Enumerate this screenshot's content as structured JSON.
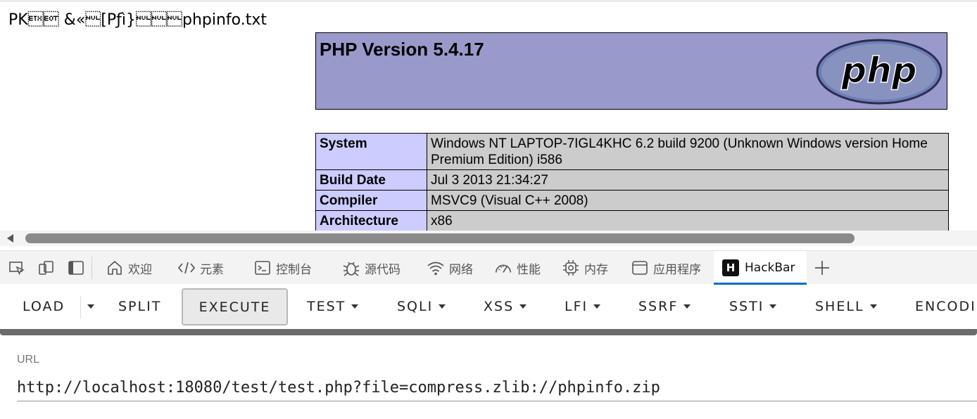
{
  "page": {
    "raw_text": "PK\u0003\u0004 &«\u0000[Pƒì}\u0000\u0000\u0000phpinfo.txt",
    "php_title": "PHP Version 5.4.17",
    "logo_text": "php",
    "info_rows": [
      {
        "key": "System",
        "value": "Windows NT LAPTOP-7IGL4KHC 6.2 build 9200 (Unknown Windows version Home Premium Edition) i586"
      },
      {
        "key": "Build Date",
        "value": "Jul 3 2013 21:34:27"
      },
      {
        "key": "Compiler",
        "value": "MSVC9 (Visual C++ 2008)"
      },
      {
        "key": "Architecture",
        "value": "x86"
      }
    ]
  },
  "devtools": {
    "tabs": [
      {
        "label": "欢迎",
        "icon": "home-icon"
      },
      {
        "label": "元素",
        "icon": "code-icon"
      },
      {
        "label": "控制台",
        "icon": "console-icon"
      },
      {
        "label": "源代码",
        "icon": "bug-icon"
      },
      {
        "label": "网络",
        "icon": "wifi-icon"
      },
      {
        "label": "性能",
        "icon": "gauge-icon"
      },
      {
        "label": "内存",
        "icon": "chip-icon"
      },
      {
        "label": "应用程序",
        "icon": "window-icon"
      },
      {
        "label": "HackBar",
        "icon": "hackbar-icon",
        "active": true
      }
    ],
    "hackbar_logo": "H"
  },
  "hackbar": {
    "buttons": {
      "load": "LOAD",
      "split": "SPLIT",
      "execute": "EXECUTE",
      "test": "TEST",
      "sqli": "SQLI",
      "xss": "XSS",
      "lfi": "LFI",
      "ssrf": "SSRF",
      "ssti": "SSTI",
      "shell": "SHELL",
      "encoding": "ENCODING"
    },
    "url_label": "URL",
    "url_value": "http://localhost:18080/test/test.php?file=compress.zlib://phpinfo.zip"
  },
  "colors": {
    "php_header_bg": "#9999cc",
    "php_key_bg": "#ccccff",
    "php_value_bg": "#cccccc",
    "active_tab_accent": "#0f6cbd"
  }
}
